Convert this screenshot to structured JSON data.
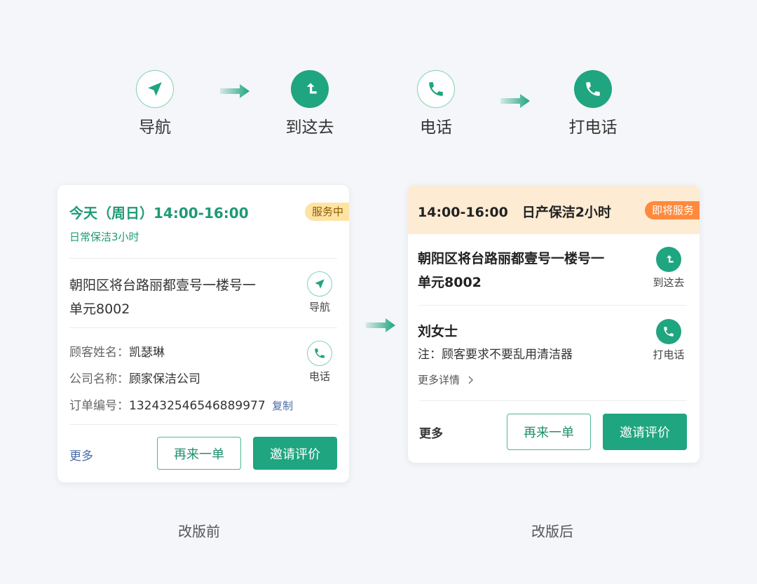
{
  "icons": [
    {
      "label": "导航",
      "style": "outline",
      "icon": "navigation-arrow-icon"
    },
    {
      "label": "到这去",
      "style": "filled",
      "icon": "turn-route-icon"
    },
    {
      "label": "电话",
      "style": "outline",
      "icon": "phone-icon"
    },
    {
      "label": "打电话",
      "style": "filled",
      "icon": "phone-icon"
    }
  ],
  "before": {
    "time": "今天（周日）14:00-16:00",
    "service": "日常保洁3小时",
    "badge": "服务中",
    "address_line1": "朝阳区将台路丽都壹号一楼号一",
    "address_line2": "单元8002",
    "nav_label": "导航",
    "phone_label": "电话",
    "customer_label": "顾客姓名：",
    "customer_value": "凯瑟琳",
    "company_label": "公司名称：",
    "company_value": "顾家保洁公司",
    "order_label": "订单编号：",
    "order_value": "132432546546889977",
    "copy_label": "复制",
    "more": "更多",
    "reorder": "再来一单",
    "invite": "邀请评价"
  },
  "after": {
    "header": "14:00-16:00   日产保洁2小时",
    "badge": "即将服务",
    "address_line1": "朝阳区将台路丽都壹号一楼号一",
    "address_line2": "单元8002",
    "go_label": "到这去",
    "customer_name": "刘女士",
    "note": "注：顾客要求不要乱用清洁器",
    "details": "更多详情",
    "call_label": "打电话",
    "more": "更多",
    "reorder": "再来一单",
    "invite": "邀请评价"
  },
  "captions": {
    "before": "改版前",
    "after": "改版后"
  },
  "colors": {
    "brand_green": "#1fa57f",
    "light_green": "#7fd1b9",
    "badge_serving_bg": "#ffe3a3",
    "badge_serving_text": "#8a5a00",
    "badge_upcoming_bg": "#ff8a3d",
    "header_bg_after": "#fdebd3",
    "link_blue": "#4a6aa8"
  }
}
